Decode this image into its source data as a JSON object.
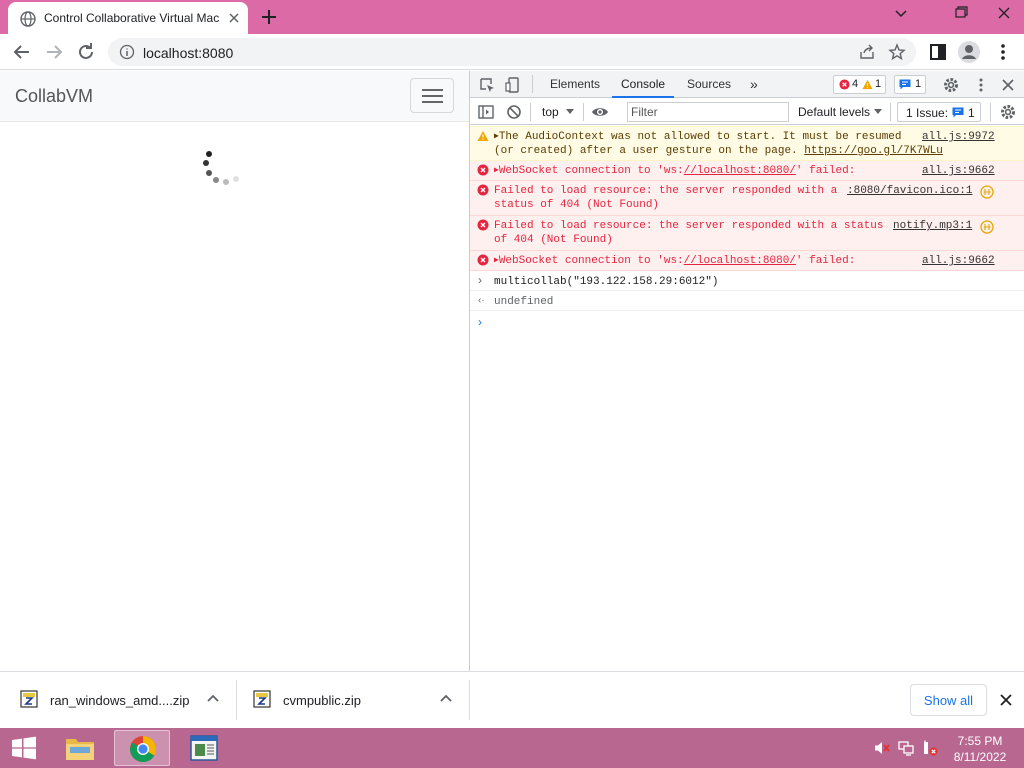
{
  "browser": {
    "tab_title": "Control Collaborative Virtual Mac",
    "url": "localhost:8080"
  },
  "page": {
    "brand": "CollabVM"
  },
  "devtools": {
    "tabs": [
      "Elements",
      "Console",
      "Sources"
    ],
    "more_tabs_label": "»",
    "error_count": "4",
    "warning_count": "1",
    "info_count": "1",
    "context": "top",
    "filter_placeholder": "Filter",
    "levels_label": "Default levels",
    "issues_label": "1 Issue:",
    "issues_count": "1",
    "messages": [
      {
        "type": "warn",
        "line1": "The AudioContext was not allowed to start. It must be resumed",
        "line2_prefix": "(or created) after a user gesture on the page. ",
        "link": "https://goo.gl/7K7WLu",
        "source": "all.js:9972"
      },
      {
        "type": "error",
        "prefix": "WebSocket connection to 'ws:",
        "link": "//localhost:8080/",
        "suffix": "' failed:",
        "source": "all.js:9662"
      },
      {
        "type": "error",
        "line1": "Failed to load resource: the server responded with a",
        "line2": "status of 404 (Not Found)",
        "source": ":8080/favicon.ico:1"
      },
      {
        "type": "error",
        "line1": "Failed to load resource: the server responded with a status",
        "line2": "of 404 (Not Found)",
        "source": "notify.mp3:1"
      },
      {
        "type": "error",
        "prefix": "WebSocket connection to 'ws:",
        "link": "//localhost:8080/",
        "suffix": "' failed:",
        "source": "all.js:9662"
      }
    ],
    "command": "multicollab(\"193.122.158.29:6012\")",
    "result": "undefined"
  },
  "downloads": {
    "items": [
      {
        "name": "ran_windows_amd....zip"
      },
      {
        "name": "cvmpublic.zip"
      }
    ],
    "show_all": "Show all"
  },
  "taskbar": {
    "time": "7:55 PM",
    "date": "8/11/2022"
  },
  "colors": {
    "titlebar": "#db6aa6",
    "taskbar": "#b86790",
    "accent": "#1a73e8",
    "error": "#e5253f",
    "warning_bg": "#fffbe5"
  }
}
